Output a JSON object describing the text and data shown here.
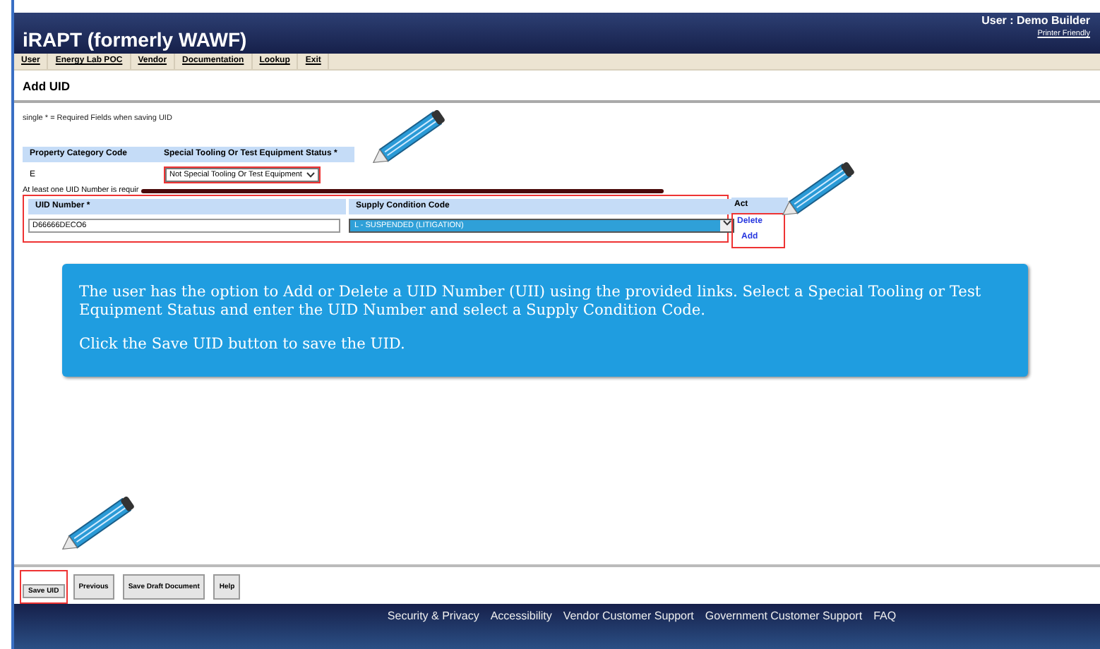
{
  "header": {
    "title": "iRAPT (formerly WAWF)",
    "user": "User : Demo Builder",
    "printer_friendly": "Printer Friendly"
  },
  "menu": [
    {
      "label": "User"
    },
    {
      "label": "Energy Lab POC"
    },
    {
      "label": "Vendor"
    },
    {
      "label": "Documentation"
    },
    {
      "label": "Lookup"
    },
    {
      "label": "Exit"
    }
  ],
  "page_title": "Add UID",
  "note": "single * = Required Fields when saving UID",
  "property_table": {
    "columns": [
      "Property Category Code",
      "Special Tooling Or Test Equipment Status *"
    ],
    "category_value": "E",
    "status_value": "Not Special Tooling Or Test Equipment"
  },
  "requirement_note": "At least one UID Number is requir",
  "uid_table": {
    "columns": [
      "UID Number *",
      "Supply Condition Code",
      "Act"
    ],
    "uid_value": "D66666DECO6",
    "condition_value": "L - SUSPENDED (LITIGATION)",
    "links": [
      "Delete",
      "Add"
    ]
  },
  "callout": [
    "The user has the option to Add or Delete a UID Number (UII) using the provided links.  Select a Special Tooling or Test Equipment Status and enter the UID Number and select a Supply Condition Code.",
    "Click the Save UID button to save the UID."
  ],
  "buttons": [
    {
      "label": "Save UID",
      "highlighted": true
    },
    {
      "label": "Previous",
      "highlighted": false
    },
    {
      "label": "Save Draft Document",
      "highlighted": false
    },
    {
      "label": "Help",
      "highlighted": false
    }
  ],
  "footer_links": [
    "Security & Privacy",
    "Accessibility",
    "Vendor Customer Support",
    "Government Customer Support",
    "FAQ"
  ]
}
